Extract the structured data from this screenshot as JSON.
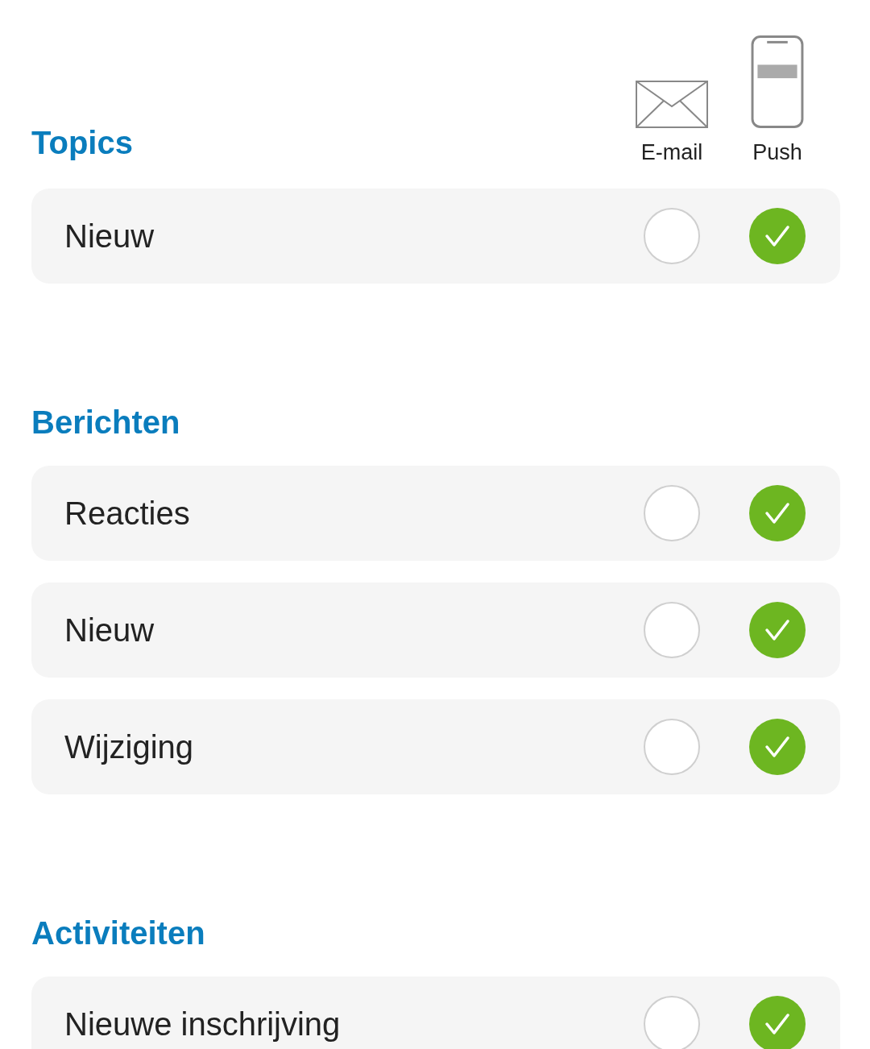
{
  "columns": [
    {
      "kind": "email",
      "label": "E-mail"
    },
    {
      "kind": "push",
      "label": "Push"
    }
  ],
  "sections": [
    {
      "title": "Topics",
      "items": [
        {
          "label": "Nieuw",
          "checked": [
            false,
            true
          ]
        }
      ]
    },
    {
      "title": "Berichten",
      "items": [
        {
          "label": "Reacties",
          "checked": [
            false,
            true
          ]
        },
        {
          "label": "Nieuw",
          "checked": [
            false,
            true
          ]
        },
        {
          "label": "Wijziging",
          "checked": [
            false,
            true
          ]
        }
      ]
    },
    {
      "title": "Activiteiten",
      "items": [
        {
          "label": "Nieuwe inschrijving",
          "checked": [
            false,
            true
          ]
        }
      ]
    }
  ]
}
